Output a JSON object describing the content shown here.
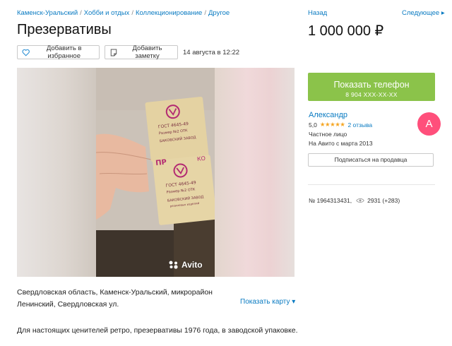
{
  "breadcrumb": [
    "Каменск-Уральский",
    "Хобби и отдых",
    "Коллекционирование",
    "Другое"
  ],
  "nav": {
    "back": "Назад",
    "next": "Следующее ▸"
  },
  "title": "Презервативы",
  "price": "1 000 000 ₽",
  "actions": {
    "favorite": "Добавить в избранное",
    "note": "Добавить заметку"
  },
  "date": "14 августа в 12:22",
  "gallery": {
    "watermark": "Avito"
  },
  "contact": {
    "show_phone": "Показать телефон",
    "phone_masked": "8 904 XXX-XX-XX"
  },
  "seller": {
    "name": "Александр",
    "rating": "5,0",
    "stars": "★★★★★",
    "reviews": "2 отзыва",
    "type": "Частное лицо",
    "since": "На Авито с марта 2013",
    "avatar_letter": "А",
    "avatar_color": "#ff4f7b",
    "subscribe": "Подписаться на продавца"
  },
  "stats": {
    "item_number": "№ 1964313431,",
    "views": "2931 (+283)"
  },
  "address": "Свердловская область, Каменск-Уральский, микрорайон Ленинский, Свердловская ул.",
  "map_link": "Показать карту ▾",
  "description": "Для настоящих ценителей ретро, презервативы 1976 года, в заводской упаковке.",
  "colors": {
    "link": "#0a7bc2",
    "accent_green": "#8bc34a",
    "star": "#f5a623"
  }
}
